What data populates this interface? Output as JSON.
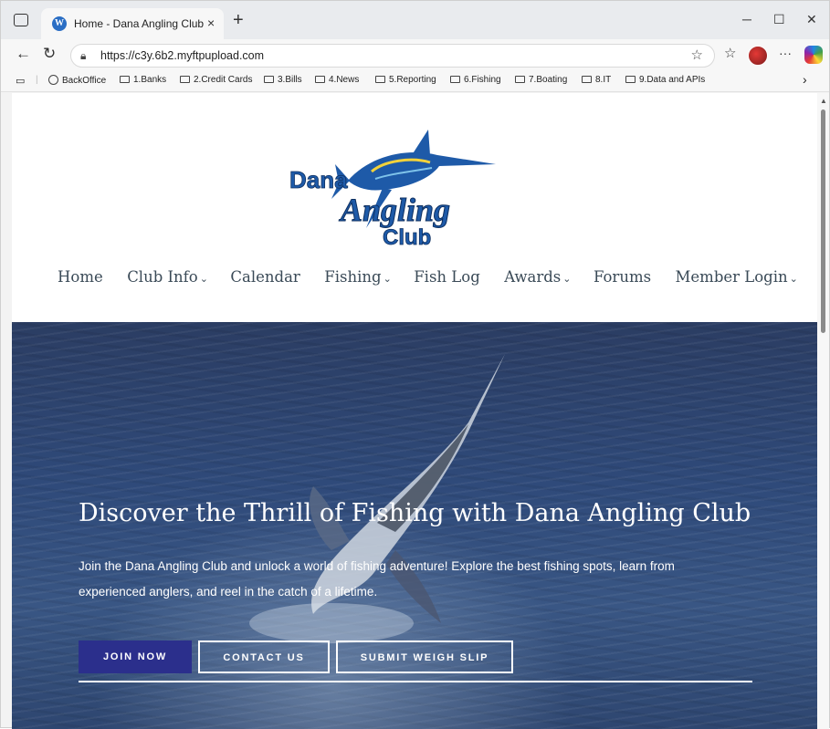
{
  "browser": {
    "tab": {
      "title": "Home - Dana Angling Club",
      "close": "×"
    },
    "new_tab": "+",
    "window_controls": {
      "minimize": "─",
      "maximize": "☐",
      "close": "✕"
    },
    "toolbar": {
      "back": "←",
      "reload": "↻",
      "url": "https://c3y.6b2.myftpupload.com",
      "star": "☆",
      "favorites": "☆",
      "more": "···"
    },
    "bookmarks": [
      {
        "label": "BackOffice",
        "icon": "globe-icon"
      },
      {
        "label": "1.Banks",
        "icon": "folder-icon"
      },
      {
        "label": "2.Credit Cards",
        "icon": "folder-icon"
      },
      {
        "label": "3.Bills",
        "icon": "folder-icon"
      },
      {
        "label": "4.News",
        "icon": "folder-icon"
      },
      {
        "label": "5.Reporting",
        "icon": "folder-icon"
      },
      {
        "label": "6.Fishing",
        "icon": "folder-icon"
      },
      {
        "label": "7.Boating",
        "icon": "folder-icon"
      },
      {
        "label": "8.IT",
        "icon": "folder-icon"
      },
      {
        "label": "9.Data and APIs",
        "icon": "folder-icon"
      }
    ],
    "bookmarks_more": "›"
  },
  "site": {
    "logo": {
      "line1": "Dana",
      "line2": "Angling",
      "line3": "Club"
    },
    "nav": [
      {
        "label": "Home",
        "caret": ""
      },
      {
        "label": "Club Info",
        "caret": "⌄"
      },
      {
        "label": "Calendar",
        "caret": ""
      },
      {
        "label": "Fishing",
        "caret": "⌄"
      },
      {
        "label": "Fish Log",
        "caret": ""
      },
      {
        "label": "Awards",
        "caret": "⌄"
      },
      {
        "label": "Forums",
        "caret": ""
      },
      {
        "label": "Member Login",
        "caret": "⌄"
      }
    ],
    "hero": {
      "title": "Discover the Thrill of Fishing with Dana Angling Club",
      "text": "Join the Dana Angling Club and unlock a world of fishing adventure! Explore the best fishing spots, learn from experienced anglers, and reel in the catch of a lifetime.",
      "buttons": {
        "join": "JOIN NOW",
        "contact": "CONTACT US",
        "weigh": "SUBMIT WEIGH SLIP"
      }
    }
  },
  "colors": {
    "accent_button": "#2b2f8c",
    "nav_text": "#3a4a57",
    "logo_blue": "#1e5aa8"
  }
}
